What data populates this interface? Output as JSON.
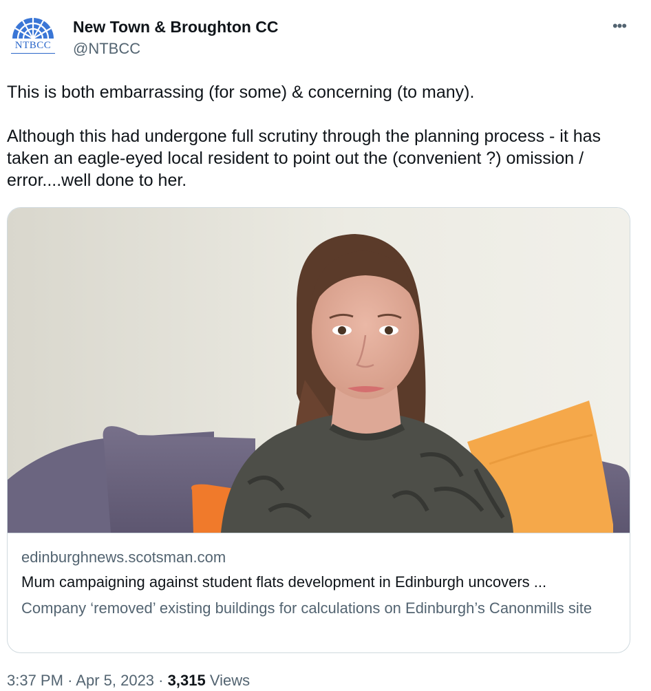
{
  "author": {
    "avatar_text": "NTBCC",
    "display_name": "New Town & Broughton CC",
    "handle": "@NTBCC"
  },
  "more_icon": "more-horizontal-icon",
  "tweet": {
    "paragraphs": [
      "This is both embarrassing (for some) & concerning (to many).",
      "Although this had undergone full scrutiny through the planning process - it has taken an eagle-eyed local resident to point out the (convenient ?) omission / error....well done to her."
    ]
  },
  "card": {
    "domain": "edinburghnews.scotsman.com",
    "title": "Mum campaigning against student flats development in Edinburgh uncovers ...",
    "description": "Company ‘removed’ existing buildings for calculations on Edinburgh’s Canonmills site"
  },
  "meta": {
    "time": "3:37 PM",
    "separator": "·",
    "date": "Apr 5, 2023",
    "views_count": "3,315",
    "views_label": "Views"
  },
  "colors": {
    "text_primary": "#0f1419",
    "text_secondary": "#536471",
    "border": "#cfd9de",
    "logo_blue": "#2a66c9"
  }
}
